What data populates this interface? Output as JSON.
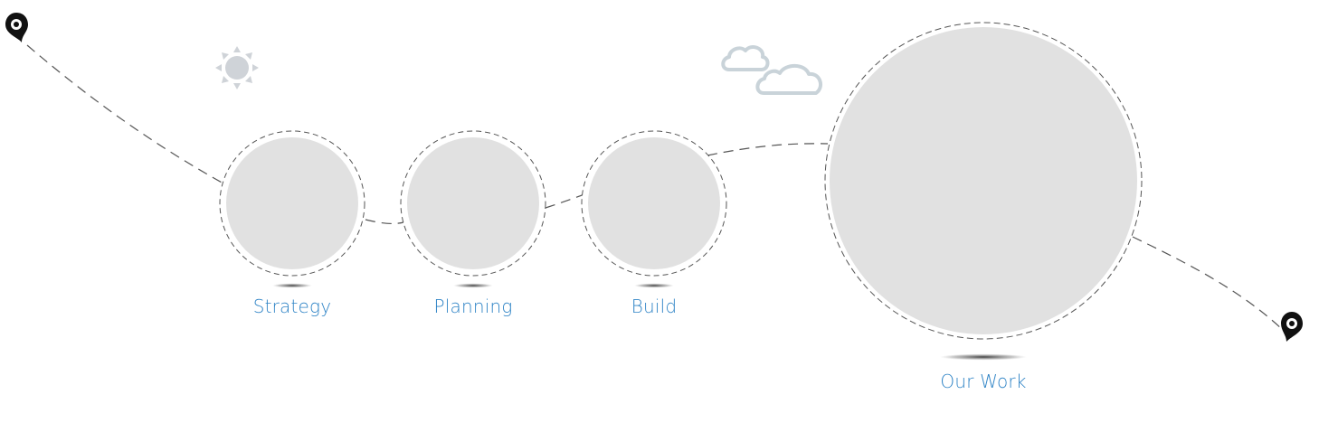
{
  "steps": [
    {
      "id": "strategy",
      "label": "Strategy"
    },
    {
      "id": "planning",
      "label": "Planning"
    },
    {
      "id": "build",
      "label": "Build"
    },
    {
      "id": "our-work",
      "label": "Our Work"
    }
  ],
  "colors": {
    "label": "#2f84c6",
    "circle_fill": "#e1e1e1",
    "dashed_path": "#555555",
    "pin": "#111111",
    "sun": "#cfd3d8",
    "cloud": "#c9d3d9"
  },
  "icons": {
    "start_pin": "map-pin-icon",
    "end_pin": "map-pin-icon",
    "sun": "sun-icon",
    "clouds": "cloud-icon"
  }
}
